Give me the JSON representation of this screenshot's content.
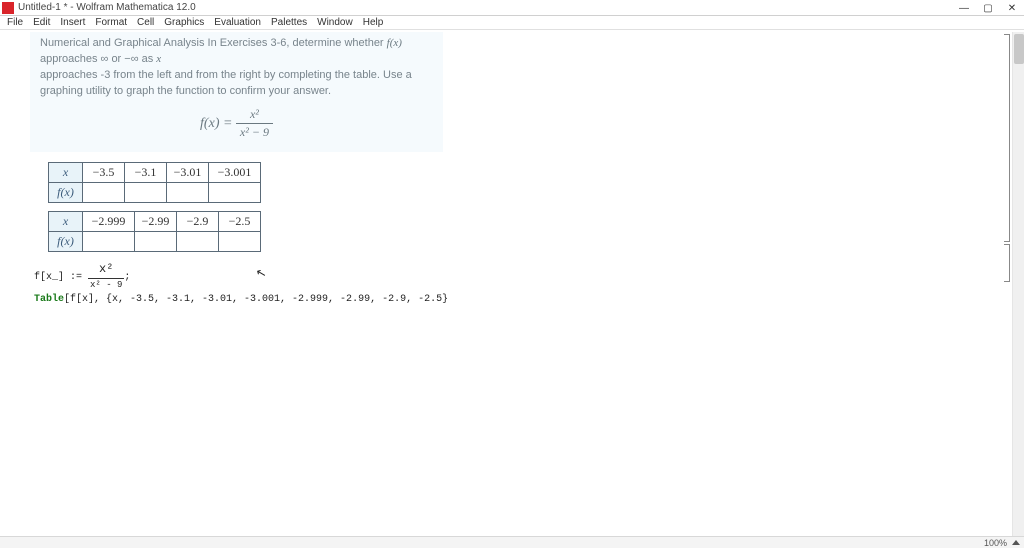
{
  "titlebar": {
    "title": "Untitled-1 * - Wolfram Mathematica 12.0",
    "app_icon_label": "W"
  },
  "window_controls": {
    "min": "—",
    "max": "▢",
    "close": "✕"
  },
  "menubar": [
    "File",
    "Edit",
    "Insert",
    "Format",
    "Cell",
    "Graphics",
    "Evaluation",
    "Palettes",
    "Window",
    "Help"
  ],
  "problem": {
    "text_a": "Numerical and Graphical Analysis In Exercises 3-6, determine whether ",
    "fx": "f(x)",
    "text_b": " approaches ∞ or −∞ as ",
    "xvar": "x",
    "text_c": "approaches -3 from the left and from the right by completing the table. Use a graphing utility to graph the function to confirm your answer.",
    "formula_lhs": "f(x) = ",
    "formula_num": "x²",
    "formula_den": "x² − 9"
  },
  "table1": {
    "row_x": "x",
    "row_fx": "f(x)",
    "cols": [
      "−3.5",
      "−3.1",
      "−3.01",
      "−3.001"
    ]
  },
  "table2": {
    "row_x": "x",
    "row_fx": "f(x)",
    "cols": [
      "−2.999",
      "−2.99",
      "−2.9",
      "−2.5"
    ]
  },
  "code": {
    "line1_a": "f[x_] := ",
    "line1_num": "x²",
    "line1_den": "x² - 9",
    "line1_b": ";",
    "line2_kw": "Table",
    "line2_rest": "[f[x], {x, -3.5, -3.1, -3.01, -3.001, -2.999, -2.99, -2.9, -2.5}"
  },
  "status": {
    "zoom": "100%"
  }
}
